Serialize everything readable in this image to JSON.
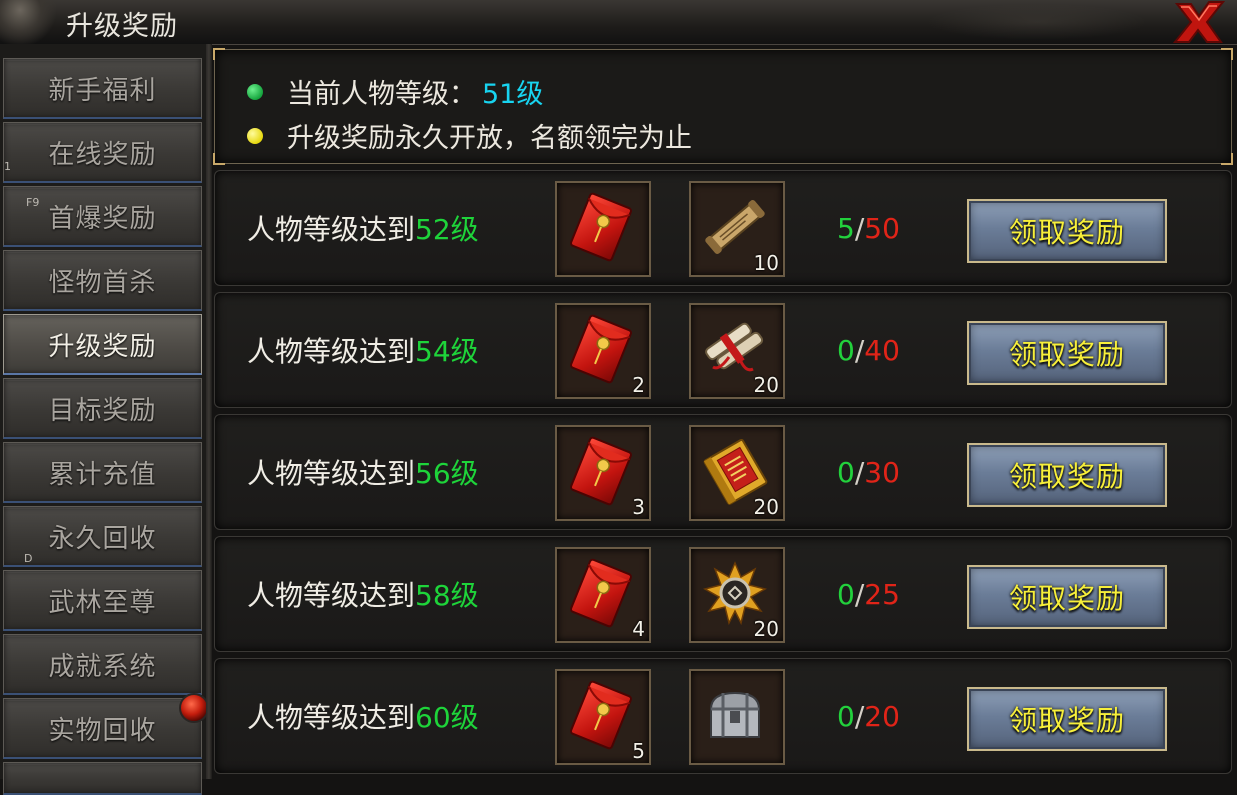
{
  "window": {
    "title": "升级奖励"
  },
  "sidebar": {
    "items": [
      {
        "label": "新手福利",
        "active": false
      },
      {
        "label": "在线奖励",
        "active": false,
        "hotkey_before": "1"
      },
      {
        "label": "首爆奖励",
        "active": false,
        "hotkey": "F9"
      },
      {
        "label": "怪物首杀",
        "active": false
      },
      {
        "label": "升级奖励",
        "active": true
      },
      {
        "label": "目标奖励",
        "active": false
      },
      {
        "label": "累计充值",
        "active": false
      },
      {
        "label": "永久回收",
        "active": false
      },
      {
        "label": "武林至尊",
        "active": false,
        "hotkey": "D"
      },
      {
        "label": "成就系统",
        "active": false
      },
      {
        "label": "实物回收",
        "active": false,
        "badge": "red-dot"
      }
    ]
  },
  "info": {
    "current_level_label": "当前人物等级：",
    "current_level_value": "51级",
    "notice": "升级奖励永久开放，名额领完为止"
  },
  "rewards": {
    "label_prefix": "人物等级达到",
    "claim_label": "领取奖励",
    "separator": "/",
    "rows": [
      {
        "level": "52级",
        "item1_icon": "red-envelope-icon",
        "item1_count": "",
        "item2_icon": "scroll-icon",
        "item2_count": "10",
        "claimed": "5",
        "total": "50"
      },
      {
        "level": "54级",
        "item1_icon": "red-envelope-icon",
        "item1_count": "2",
        "item2_icon": "scroll-bundle-icon",
        "item2_count": "20",
        "claimed": "0",
        "total": "40"
      },
      {
        "level": "56级",
        "item1_icon": "red-envelope-icon",
        "item1_count": "3",
        "item2_icon": "book-icon",
        "item2_count": "20",
        "claimed": "0",
        "total": "30"
      },
      {
        "level": "58级",
        "item1_icon": "red-envelope-icon",
        "item1_count": "4",
        "item2_icon": "emblem-icon",
        "item2_count": "20",
        "claimed": "0",
        "total": "25"
      },
      {
        "level": "60级",
        "item1_icon": "red-envelope-icon",
        "item1_count": "5",
        "item2_icon": "treasure-chest-icon",
        "item2_count": "",
        "claimed": "0",
        "total": "20"
      }
    ]
  },
  "colors": {
    "level_green": "#1ed43a",
    "level_cyan": "#18d4f0",
    "total_red": "#e02418",
    "button_text_yellow": "#f7ef3a"
  }
}
